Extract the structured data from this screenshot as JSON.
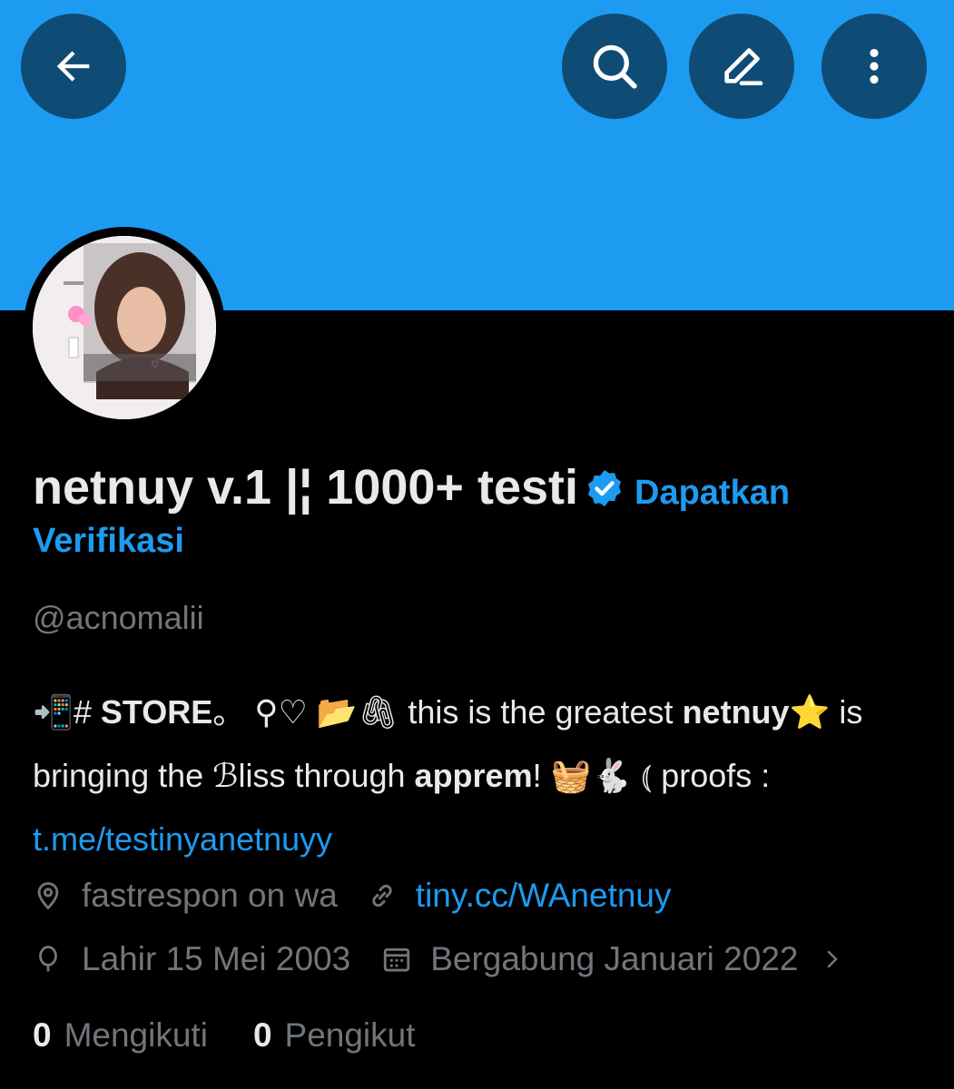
{
  "header": {
    "back_icon": "arrow-left-icon",
    "search_icon": "search-icon",
    "edit_icon": "pencil-icon",
    "more_icon": "more-vertical-icon",
    "banner_color": "#1d9bf0",
    "button_color": "#0f4c75"
  },
  "profile": {
    "display_name": "netnuy v.1 |¦ 1000+ testi",
    "verified_icon": "verified-badge-icon",
    "get_verified_1": "Dapatkan",
    "get_verified_2": "Verifikasi",
    "handle": "@acnomalii"
  },
  "bio": {
    "p1": "📲# ",
    "p1_bold": "STORE",
    "p2": "。 ⚲♡ 📂🖇 this is the greatest ",
    "p2_bold": "netnuy",
    "p3": "⭐ is bringing the ℬliss through ",
    "p3_bold": "apprem",
    "p4": "! 🧺🐇 ⦅ proofs : ",
    "link": "t.me/testinyanetnuyy"
  },
  "meta": {
    "location": "fastrespon on wa",
    "website": "tiny.cc/WAnetnuy",
    "birthday": "Lahir 15 Mei 2003",
    "joined": "Bergabung Januari 2022"
  },
  "stats": {
    "following_count": "0",
    "following_label": "Mengikuti",
    "followers_count": "0",
    "followers_label": "Pengikut"
  }
}
